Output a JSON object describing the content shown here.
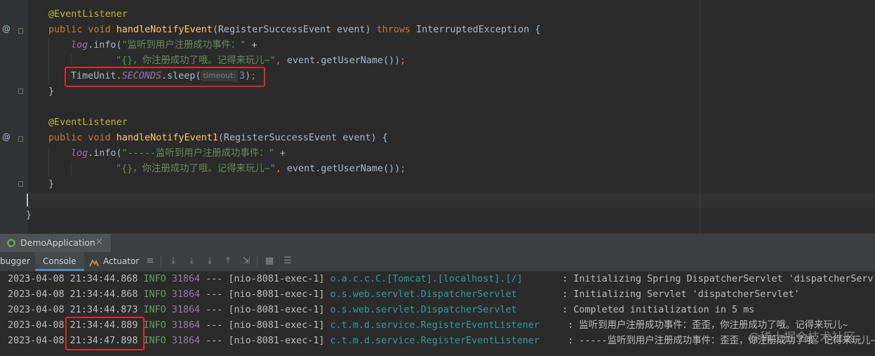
{
  "editor": {
    "lines": [
      {
        "tokens": [
          {
            "c": "ann",
            "t": "@EventListener"
          }
        ]
      },
      {
        "tokens": [
          {
            "c": "kw",
            "t": "public void "
          },
          {
            "c": "fn",
            "t": "handleNotifyEvent"
          },
          {
            "c": "plain",
            "t": "(RegisterSuccessEvent event) "
          },
          {
            "c": "kw",
            "t": "throws "
          },
          {
            "c": "plain",
            "t": "InterruptedException {"
          }
        ]
      },
      {
        "tokens": [
          {
            "c": "fld",
            "t": "log"
          },
          {
            "c": "plain",
            "t": ".info("
          },
          {
            "c": "str",
            "t": "\"监听到用户注册成功事件：\""
          },
          {
            "c": "plain",
            "t": " +"
          }
        ]
      },
      {
        "tokens": [
          {
            "c": "str",
            "t": "\"{}，你注册成功了哦。记得来玩儿~\""
          },
          {
            "c": "kw",
            "t": ", "
          },
          {
            "c": "plain",
            "t": "event.getUserName())"
          },
          {
            "c": "kw",
            "t": ";"
          }
        ]
      },
      {
        "tokens": [
          {
            "c": "plain",
            "t": "TimeUnit."
          },
          {
            "c": "fld",
            "t": "SECONDS"
          },
          {
            "c": "plain",
            "t": ".sleep("
          },
          {
            "c": "hint",
            "t": "timeout:"
          },
          {
            "c": "num",
            "t": "3"
          },
          {
            "c": "plain",
            "t": ")"
          },
          {
            "c": "kw",
            "t": ";"
          }
        ]
      },
      {
        "tokens": [
          {
            "c": "plain",
            "t": "}"
          }
        ]
      },
      {
        "tokens": []
      },
      {
        "tokens": [
          {
            "c": "ann",
            "t": "@EventListener"
          }
        ]
      },
      {
        "tokens": [
          {
            "c": "kw",
            "t": "public void "
          },
          {
            "c": "fn",
            "t": "handleNotifyEvent1"
          },
          {
            "c": "plain",
            "t": "(RegisterSuccessEvent event) {"
          }
        ]
      },
      {
        "tokens": [
          {
            "c": "fld",
            "t": "log"
          },
          {
            "c": "plain",
            "t": ".info("
          },
          {
            "c": "str",
            "t": "\"-----监听到用户注册成功事件：\""
          },
          {
            "c": "plain",
            "t": " +"
          }
        ]
      },
      {
        "tokens": [
          {
            "c": "str",
            "t": "\"{}，你注册成功了哦。记得来玩儿~\""
          },
          {
            "c": "kw",
            "t": ", "
          },
          {
            "c": "plain",
            "t": "event.getUserName())"
          },
          {
            "c": "kw",
            "t": ";"
          }
        ]
      },
      {
        "tokens": [
          {
            "c": "plain",
            "t": "}"
          }
        ]
      },
      {
        "tokens": []
      },
      {
        "tokens": [
          {
            "c": "plain",
            "t": "}"
          }
        ]
      }
    ],
    "gutter_marks": [
      "@",
      "@"
    ]
  },
  "run_window": {
    "tab_label": "DemoApplication",
    "tab_close": "×",
    "toolbar_tabs": [
      "bugger",
      "Console",
      "Actuator"
    ]
  },
  "console": {
    "lines": [
      {
        "date": "2023-04-08 21:34:44.868",
        "level": "INFO",
        "pid": "31864",
        "sep": " --- ",
        "thread": "[nio-8081-exec-1]",
        "logger": "o.a.c.c.C.[Tomcat].[localhost].[/]      ",
        "msg": " : Initializing Spring DispatcherServlet 'dispatcherServlet'"
      },
      {
        "date": "2023-04-08 21:34:44.868",
        "level": "INFO",
        "pid": "31864",
        "sep": " --- ",
        "thread": "[nio-8081-exec-1]",
        "logger": "o.s.web.servlet.DispatcherServlet       ",
        "msg": " : Initializing Servlet 'dispatcherServlet'"
      },
      {
        "date": "2023-04-08 21:34:44.873",
        "level": "INFO",
        "pid": "31864",
        "sep": " --- ",
        "thread": "[nio-8081-exec-1]",
        "logger": "o.s.web.servlet.DispatcherServlet       ",
        "msg": " : Completed initialization in 5 ms"
      },
      {
        "date": "2023-04-08 21:34:44.889",
        "level": "INFO",
        "pid": "31864",
        "sep": " --- ",
        "thread": "[nio-8081-exec-1]",
        "logger": "c.t.m.d.service.RegisterEventListener    ",
        "msg": " : 监听到用户注册成功事件：歪歪，你注册成功了哦。记得来玩儿~"
      },
      {
        "date": "2023-04-08 21:34:47.898",
        "level": "INFO",
        "pid": "31864",
        "sep": " --- ",
        "thread": "[nio-8081-exec-1]",
        "logger": "c.t.m.d.service.RegisterEventListener    ",
        "msg": " : -----监听到用户注册成功事件：歪歪，你注册成功了哦。记得来玩儿~"
      }
    ]
  },
  "watermark": "@稀土掘金技术社区"
}
